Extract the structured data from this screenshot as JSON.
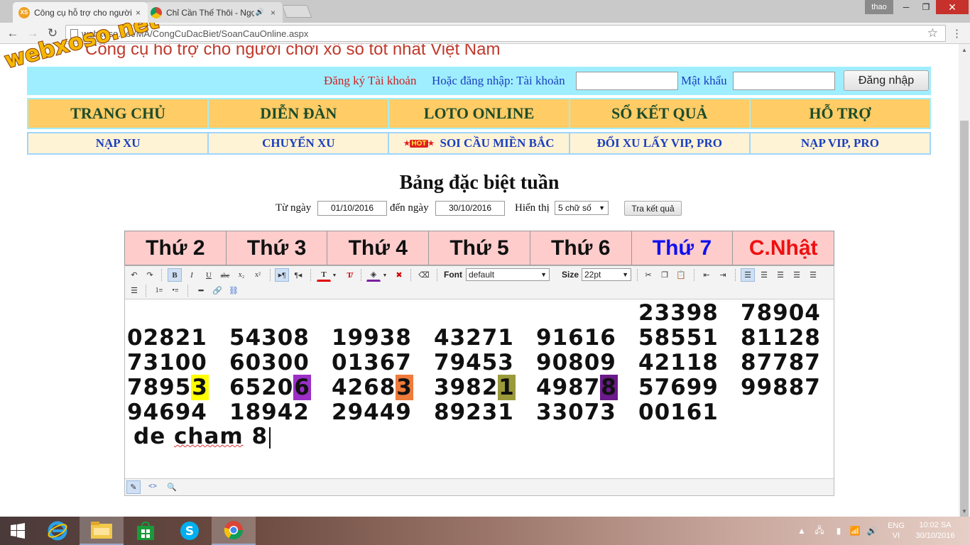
{
  "browser": {
    "tabs": [
      {
        "title": "Công cụ hỗ trợ cho người chơi xổ số tốt nhất Việt Nam",
        "favicon": "XS"
      },
      {
        "title": "Chỉ Cần Thế Thôi - Ngọc Kara",
        "close": "×"
      }
    ],
    "tab1_close": "×",
    "audio_icon": "🔊",
    "user": "thao",
    "window": {
      "minimize": "─",
      "maximize": "❐",
      "close": "✕"
    },
    "url": "webxoso.net/MA/CongCuDacBiet/SoanCauOnline.aspx",
    "watermark": "webxoso.net"
  },
  "site": {
    "heading": "Công cụ hỗ trợ cho người chơi xổ số tốt nhất Việt Nam",
    "register_link": "Đăng ký Tài khoản",
    "login_prompt": "Hoặc đăng nhập: Tài khoản",
    "password_label": "Mật khẩu",
    "login_button": "Đăng nhập",
    "main_menu": [
      "TRANG CHỦ",
      "DIỄN ĐÀN",
      "LOTO ONLINE",
      "SỔ KẾT QUẢ",
      "HỖ TRỢ"
    ],
    "sub_menu": [
      "NẠP XU",
      "CHUYỂN XU",
      "SOI CẦU MIỀN BẮC",
      "ĐỔI XU LẤY VIP, PRO",
      "NẠP VIP, PRO"
    ],
    "hot_badge": "HOT"
  },
  "page": {
    "title": "Bảng đặc biệt tuần",
    "filter": {
      "from_label": "Từ ngày",
      "from_value": "01/10/2016",
      "to_label": "đến ngày",
      "to_value": "30/10/2016",
      "show_label": "Hiển thị",
      "show_value": "5 chữ số",
      "search_button": "Tra kết quả"
    },
    "days": [
      {
        "label": "Thứ 2",
        "color": "#111111"
      },
      {
        "label": "Thứ 3",
        "color": "#111111"
      },
      {
        "label": "Thứ 4",
        "color": "#111111"
      },
      {
        "label": "Thứ 5",
        "color": "#111111"
      },
      {
        "label": "Thứ 6",
        "color": "#111111"
      },
      {
        "label": "Thứ 7",
        "color": "#1010ee"
      },
      {
        "label": "C.Nhật",
        "color": "#ee1010"
      }
    ]
  },
  "editor": {
    "font_label": "Font",
    "font_value": "default",
    "size_label": "Size",
    "size_value": "22pt",
    "rows": [
      [
        "",
        "",
        "",
        "",
        "",
        "23398",
        "78904"
      ],
      [
        "02821",
        "54308",
        "19938",
        "43271",
        "91616",
        "58551",
        "81128"
      ],
      [
        "73100",
        "60300",
        "01367",
        "79453",
        "90809",
        "42118",
        "87787"
      ],
      [
        "78953",
        "65206",
        "42683",
        "39821",
        "49878",
        "57699",
        "99887"
      ],
      [
        "94694",
        "18942",
        "29449",
        "89231",
        "33073",
        "00161",
        ""
      ]
    ],
    "highlights": [
      {
        "row": 3,
        "col": 0,
        "color": "#ffff00"
      },
      {
        "row": 3,
        "col": 1,
        "color": "#9b2fc6"
      },
      {
        "row": 3,
        "col": 2,
        "color": "#f07a3a"
      },
      {
        "row": 3,
        "col": 3,
        "color": "#9a9a3a"
      },
      {
        "row": 3,
        "col": 4,
        "color": "#6a1a8a"
      }
    ],
    "note_prefix": "de ",
    "note_word": "cham",
    "note_suffix": " 8"
  },
  "taskbar": {
    "lang_top": "ENG",
    "lang_bottom": "VI",
    "time": "10:02 SA",
    "date": "30/10/2016"
  }
}
